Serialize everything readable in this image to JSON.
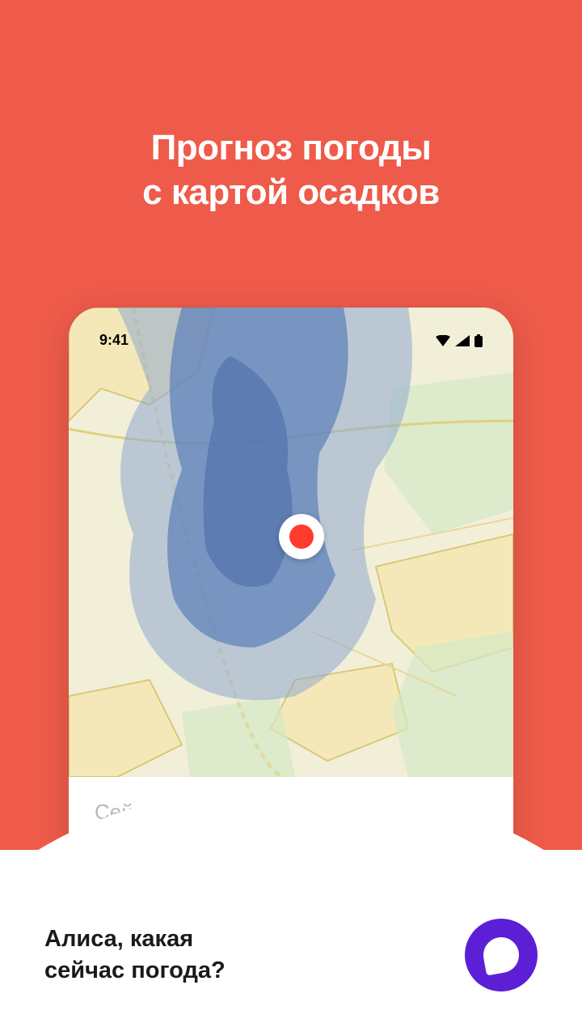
{
  "hero": {
    "title_line1": "Прогноз погоды",
    "title_line2": "с картой осадков"
  },
  "phone": {
    "status_bar": {
      "time": "9:41"
    },
    "weather": {
      "status_text": "Сейчас гроза"
    }
  },
  "bottom": {
    "prompt_line1": "Алиса, какая",
    "prompt_line2": "сейчас погода?"
  },
  "colors": {
    "primary": "#ee5b4a",
    "alice": "#5c1fd6",
    "marker": "#ff3b30"
  }
}
